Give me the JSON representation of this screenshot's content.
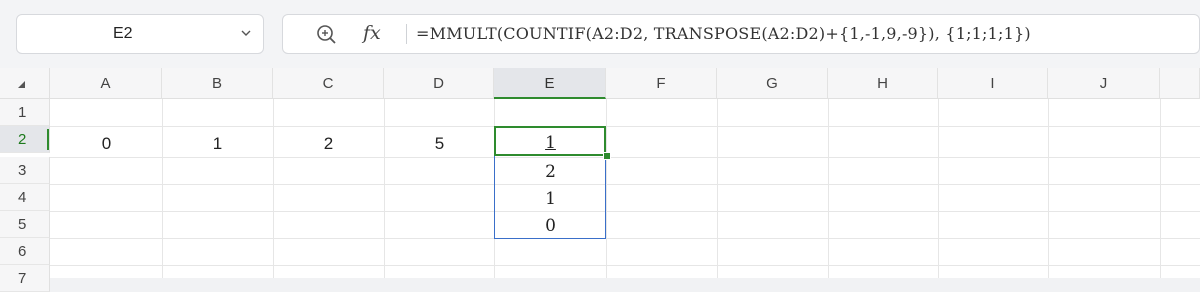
{
  "name_box": {
    "value": "E2"
  },
  "formula_bar": {
    "formula": "=MMULT(COUNTIF(A2:D2, TRANSPOSE(A2:D2)+{1,-1,9,-9}), {1;1;1;1})",
    "fx_label": "fx"
  },
  "columns": [
    "A",
    "B",
    "C",
    "D",
    "E",
    "F",
    "G",
    "H",
    "I",
    "J"
  ],
  "rows": [
    "1",
    "2",
    "3",
    "4",
    "5",
    "6",
    "7"
  ],
  "selected": {
    "column": "E",
    "row": "2"
  },
  "cells": {
    "A2": "0",
    "B2": "1",
    "C2": "2",
    "D2": "5",
    "E2": "1",
    "E3": "2",
    "E4": "1",
    "E5": "0"
  },
  "colors": {
    "selection_green": "#2e8b2e",
    "spill_blue": "#3a6fc9"
  },
  "icons": {
    "zoom": "zoom-formula-icon",
    "namebox_dropdown": "chevron-down-icon"
  }
}
